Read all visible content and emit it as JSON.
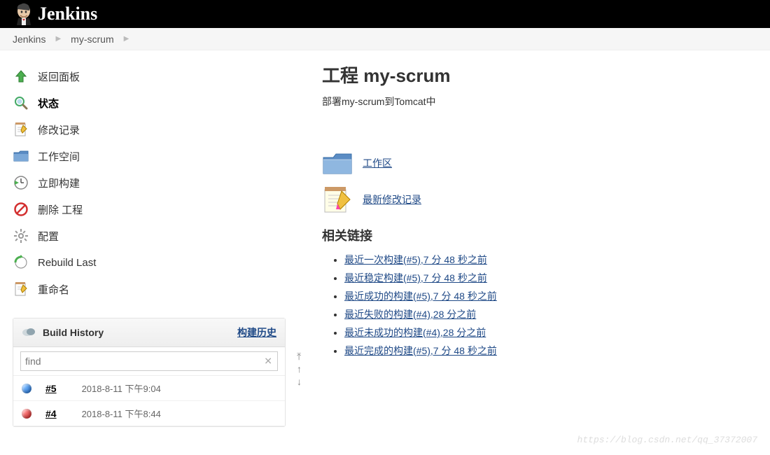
{
  "header": {
    "logo_text": "Jenkins"
  },
  "breadcrumbs": {
    "root": "Jenkins",
    "project": "my-scrum"
  },
  "sidebar": {
    "items": [
      {
        "label": "返回面板"
      },
      {
        "label": "状态",
        "bold": true
      },
      {
        "label": "修改记录"
      },
      {
        "label": "工作空间"
      },
      {
        "label": "立即构建"
      },
      {
        "label": "删除 工程"
      },
      {
        "label": "配置"
      },
      {
        "label": "Rebuild Last"
      },
      {
        "label": "重命名"
      }
    ]
  },
  "history": {
    "title": "Build History",
    "link": "构建历史",
    "find_placeholder": "find",
    "builds": [
      {
        "num": "#5",
        "date": "2018-8-11 下午9:04",
        "status": "blue"
      },
      {
        "num": "#4",
        "date": "2018-8-11 下午8:44",
        "status": "red"
      }
    ]
  },
  "main": {
    "title": "工程 my-scrum",
    "desc": "部署my-scrum到Tomcat中",
    "workspace_link": "工作区",
    "changes_link": "最新修改记录",
    "related_heading": "相关链接",
    "related": [
      "最近一次构建(#5),7 分 48 秒之前",
      "最近稳定构建(#5),7 分 48 秒之前",
      "最近成功的构建(#5),7 分 48 秒之前",
      "最近失败的构建(#4),28 分之前",
      "最近未成功的构建(#4),28 分之前",
      "最近完成的构建(#5),7 分 48 秒之前"
    ]
  },
  "watermark": "https://blog.csdn.net/qq_37372007"
}
